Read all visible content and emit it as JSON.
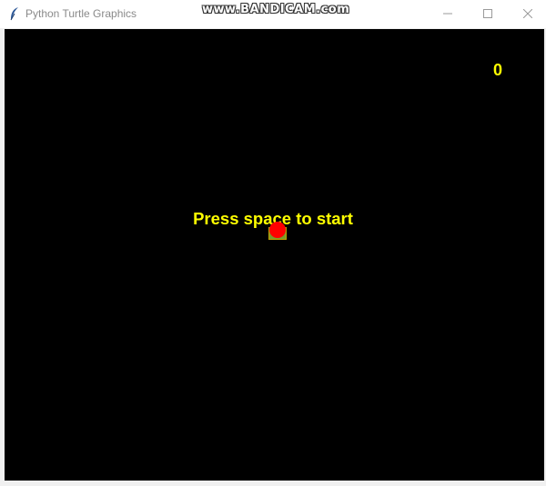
{
  "window": {
    "title": "Python Turtle Graphics",
    "watermark": "www.BANDICAM.com"
  },
  "icons": {
    "app": "feather-icon",
    "minimize": "minimize-icon",
    "maximize": "maximize-icon",
    "close": "close-icon"
  },
  "game": {
    "score": "0",
    "start_message": "Press space to start",
    "colors": {
      "background": "#000000",
      "text": "#ffff00",
      "food": "#ff0000",
      "snake": "#7a9a2a"
    }
  }
}
